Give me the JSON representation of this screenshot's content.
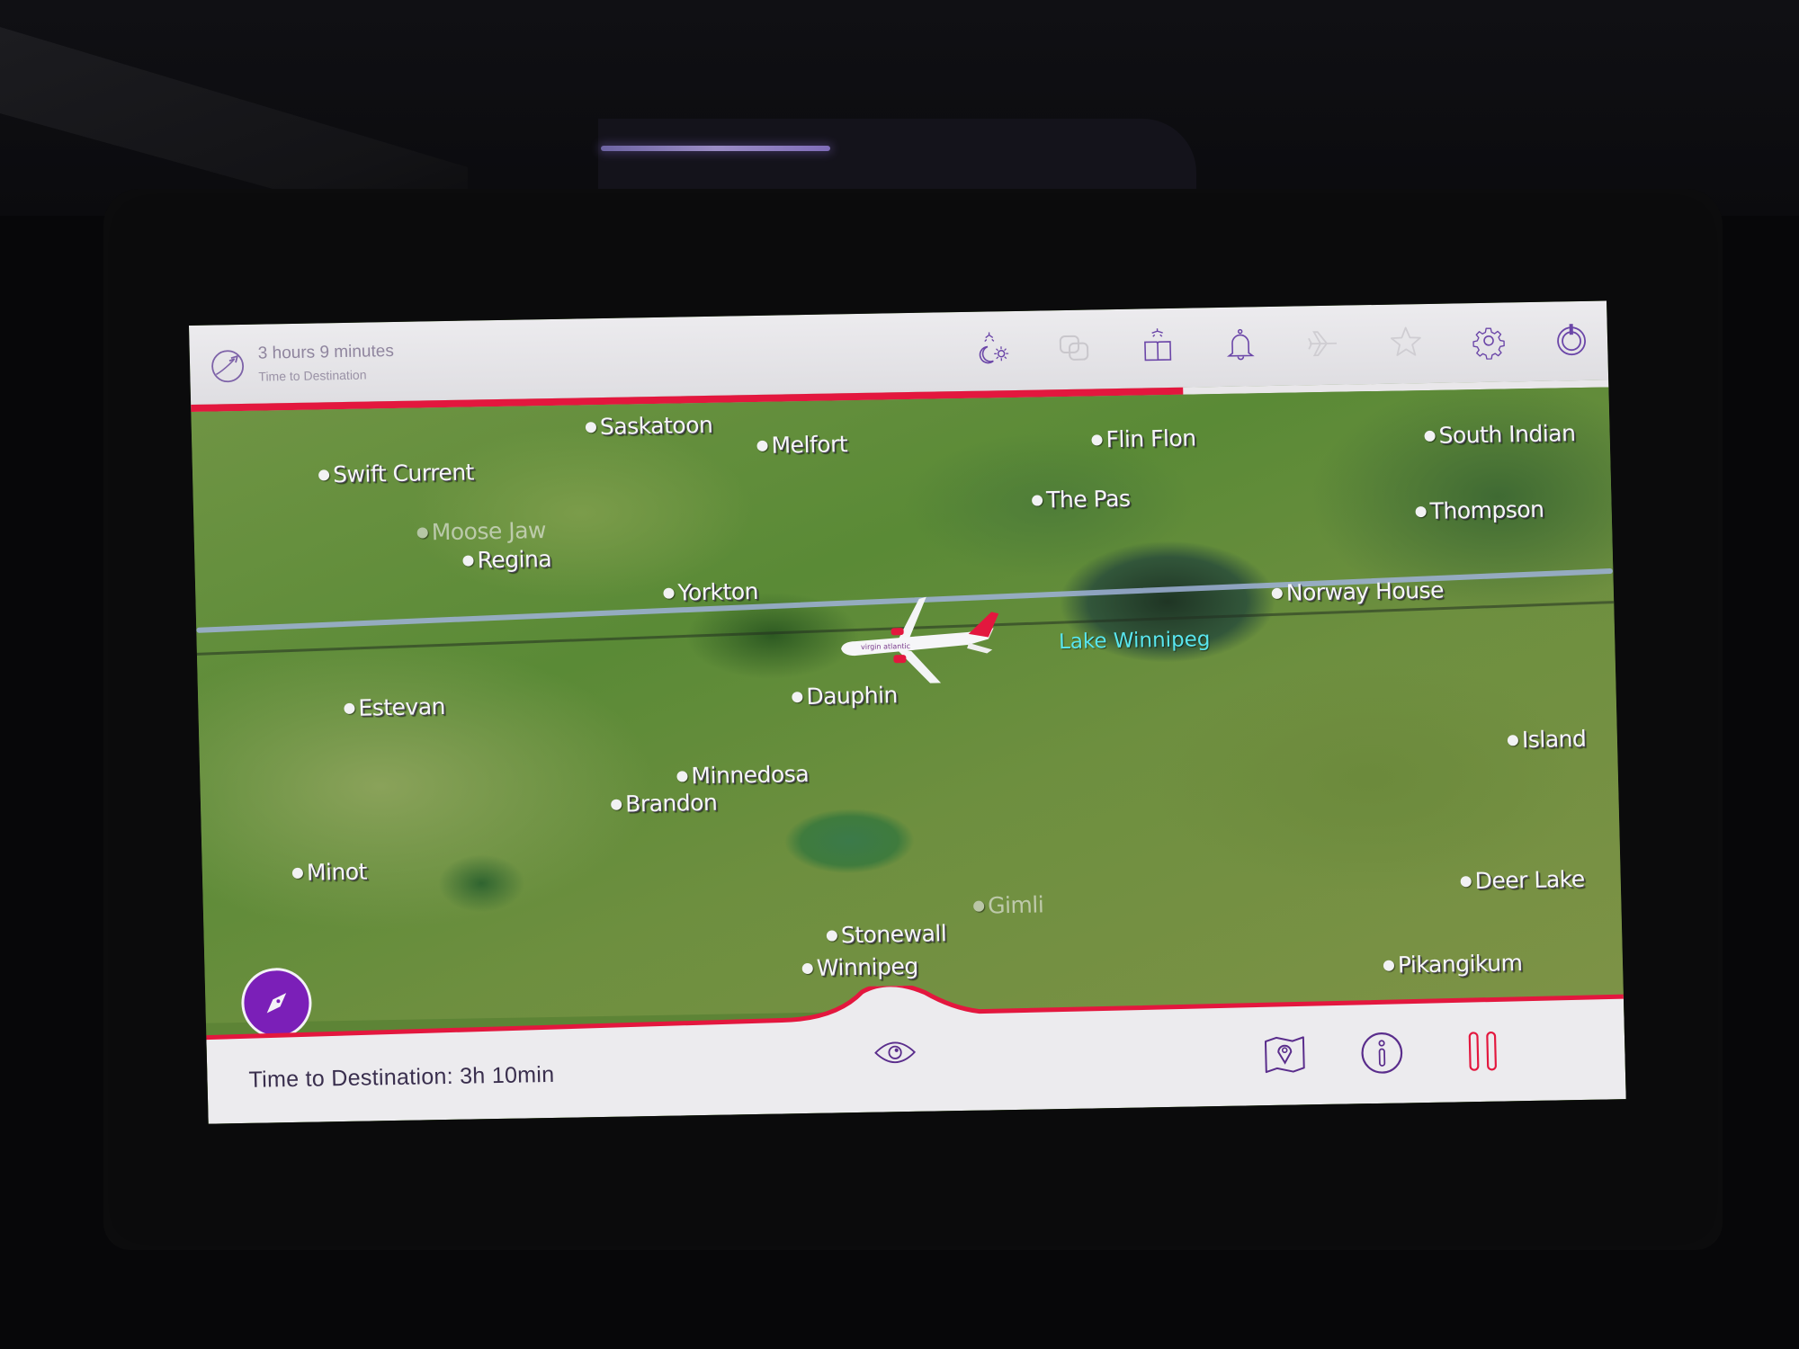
{
  "topbar": {
    "eta_primary": "3 hours 9 minutes",
    "eta_secondary": "Time to Destination",
    "progress_fraction": 0.7,
    "icons": [
      {
        "name": "day-night-icon",
        "enabled": true
      },
      {
        "name": "multi-screen-icon",
        "enabled": false
      },
      {
        "name": "reading-light-icon",
        "enabled": true
      },
      {
        "name": "call-attendant-bell-icon",
        "enabled": true
      },
      {
        "name": "flight-icon",
        "enabled": false
      },
      {
        "name": "favorites-star-icon",
        "enabled": false
      },
      {
        "name": "settings-gear-icon",
        "enabled": true
      },
      {
        "name": "power-icon",
        "enabled": true
      }
    ]
  },
  "map": {
    "cities": [
      {
        "name": "Saskatoon"
      },
      {
        "name": "Melfort"
      },
      {
        "name": "Flin Flon"
      },
      {
        "name": "South Indian"
      },
      {
        "name": "Swift Current"
      },
      {
        "name": "The Pas"
      },
      {
        "name": "Thompson"
      },
      {
        "name": "Moose Jaw",
        "faded": true
      },
      {
        "name": "Regina"
      },
      {
        "name": "Yorkton"
      },
      {
        "name": "Norway House"
      },
      {
        "name": "Estevan"
      },
      {
        "name": "Dauphin"
      },
      {
        "name": "Island"
      },
      {
        "name": "Minnedosa"
      },
      {
        "name": "Brandon"
      },
      {
        "name": "Minot"
      },
      {
        "name": "Deer Lake"
      },
      {
        "name": "Gimli",
        "faded": true
      },
      {
        "name": "Stonewall"
      },
      {
        "name": "Winnipeg"
      },
      {
        "name": "Pikangikum"
      }
    ],
    "water_labels": [
      "Lake Winnipeg"
    ],
    "aircraft_livery": "virgin atlantic"
  },
  "bottombar": {
    "time_to_destination": "Time to Destination: 3h 10min"
  },
  "colors": {
    "accent_red": "#e3173e",
    "icon_purple": "#6a3aa8",
    "compass_purple": "#7b1fb8",
    "water_label": "#59e6ee"
  }
}
